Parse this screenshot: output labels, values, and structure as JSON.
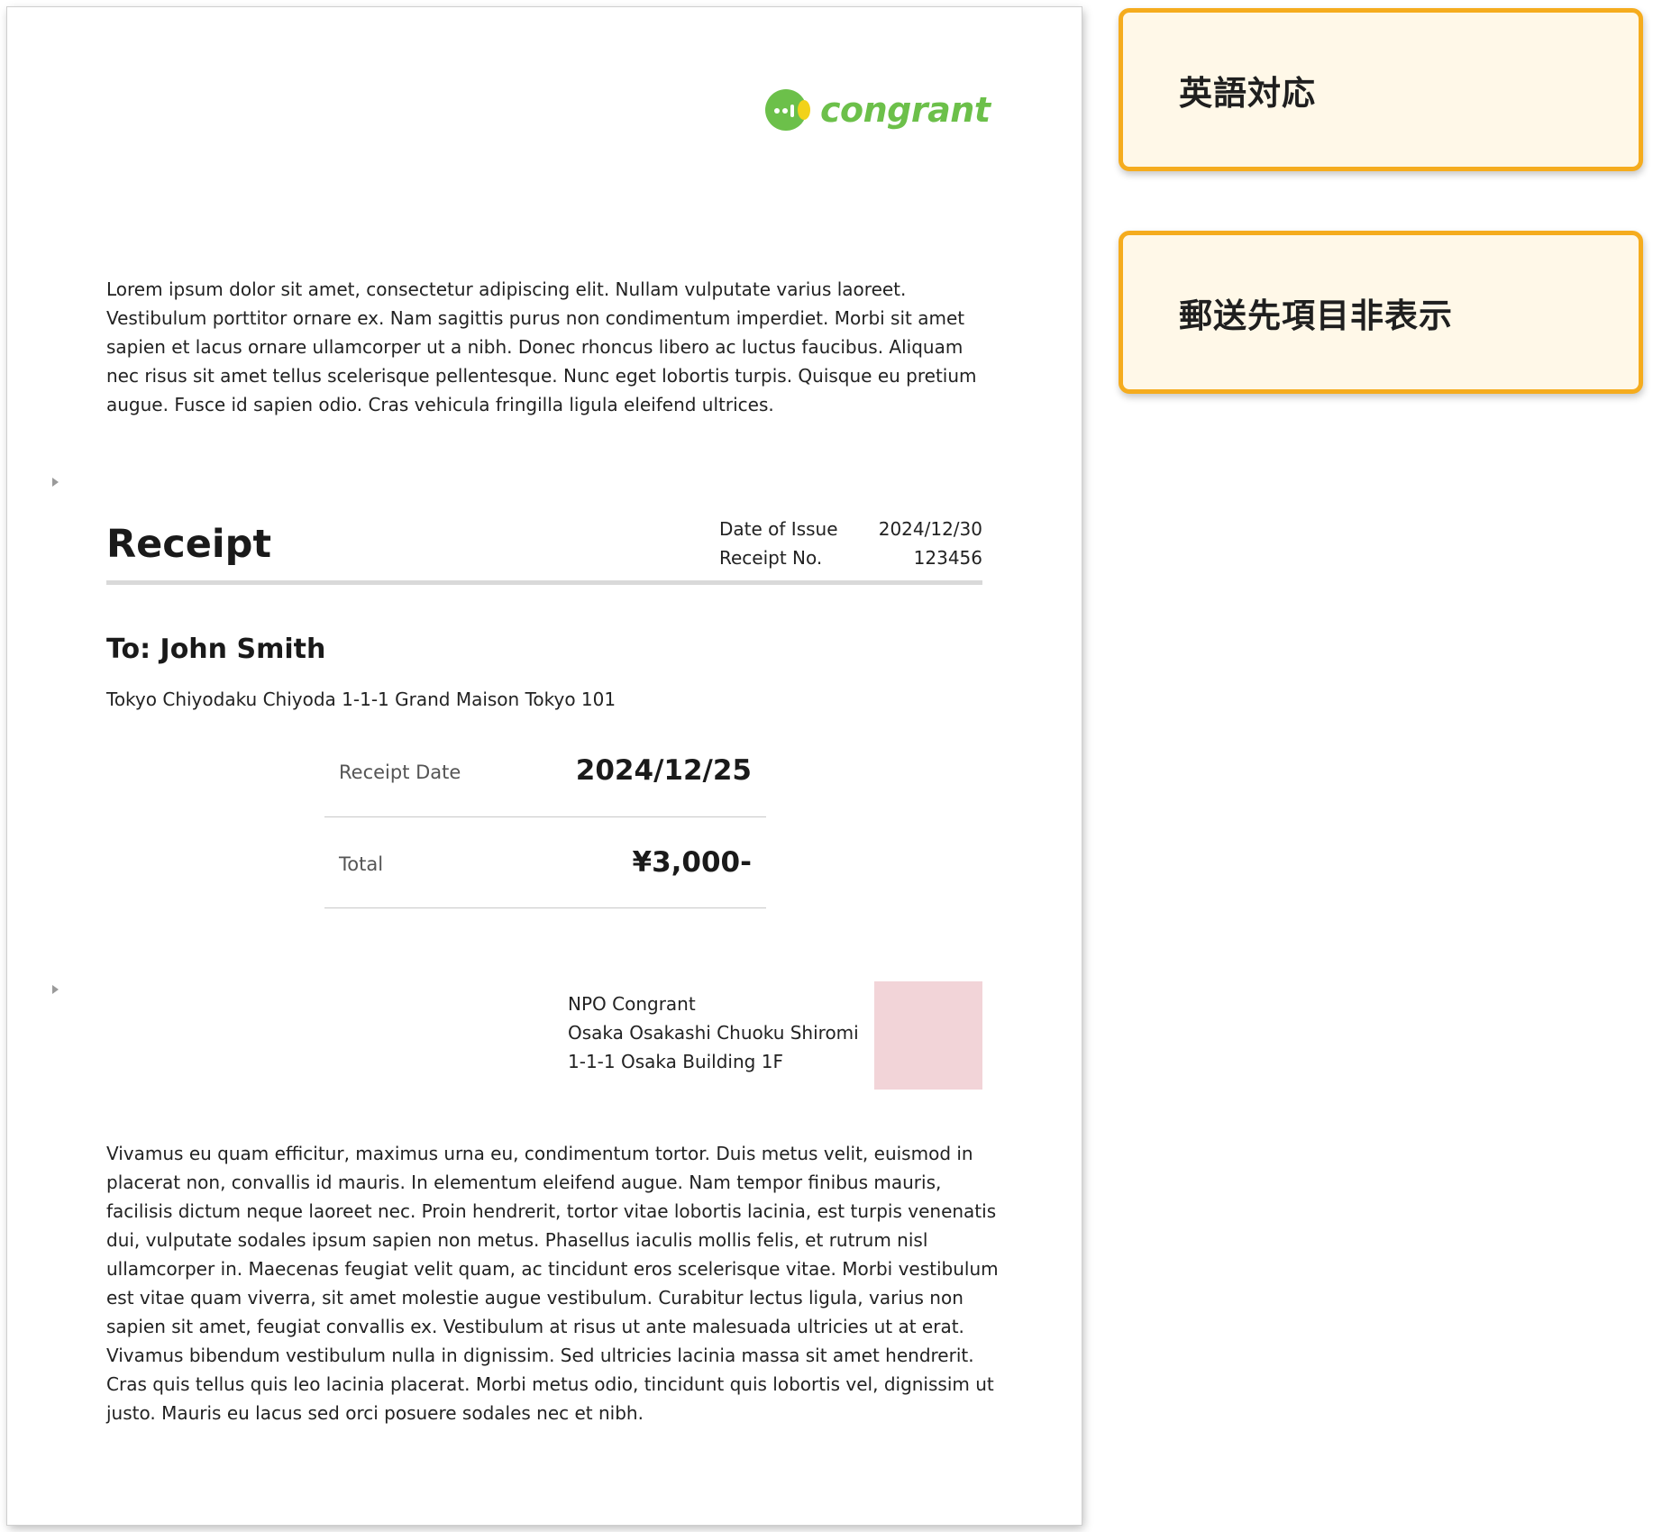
{
  "logo": {
    "text": "congrant",
    "color": "#6cc04a",
    "accent_color": "#f2d21a"
  },
  "intro_text": "Lorem ipsum dolor sit amet, consectetur adipiscing elit. Nullam vulputate varius laoreet. Vestibulum porttitor ornare ex. Nam sagittis purus non condimentum imperdiet. Morbi sit amet sapien et lacus ornare ullamcorper ut a nibh. Donec rhoncus libero ac luctus faucibus. Aliquam nec risus sit amet tellus scelerisque pellentesque. Nunc eget lobortis turpis. Quisque eu pretium augue. Fusce id sapien odio. Cras vehicula fringilla ligula eleifend ultrices.",
  "receipt": {
    "title": "Receipt",
    "date_of_issue_label": "Date of Issue",
    "date_of_issue": "2024/12/30",
    "receipt_no_label": "Receipt No.",
    "receipt_no": "123456"
  },
  "recipient": {
    "name": "To: John Smith",
    "address": "Tokyo Chiyodaku Chiyoda 1-1-1 Grand Maison Tokyo 101"
  },
  "summary": {
    "receipt_date_label": "Receipt Date",
    "receipt_date": "2024/12/25",
    "total_label": "Total",
    "total": "¥3,000-"
  },
  "issuer": {
    "name": "NPO Congrant",
    "address_line1": "Osaka Osakashi Chuoku Shiromi",
    "address_line2": "1-1-1 Osaka Building 1F",
    "stamp_color": "#f2d4d8"
  },
  "outro_text": "Vivamus eu quam efficitur, maximus urna eu, condimentum tortor. Duis metus velit, euismod in placerat non, convallis id mauris. In elementum eleifend augue. Nam tempor finibus mauris, facilisis dictum neque laoreet nec. Proin hendrerit, tortor vitae lobortis lacinia, est turpis venenatis dui, vulputate sodales ipsum sapien non metus. Phasellus iaculis mollis felis, et rutrum nisl ullamcorper in. Maecenas feugiat velit quam, ac tincidunt eros scelerisque vitae. Morbi vestibulum est vitae quam viverra, sit amet molestie augue vestibulum. Curabitur lectus ligula, varius non sapien sit amet, feugiat convallis ex. Vestibulum at risus ut ante malesuada ultricies ut at erat. Vivamus bibendum vestibulum nulla in dignissim. Sed ultricies lacinia massa sit amet hendrerit. Cras quis tellus quis leo lacinia placerat. Morbi metus odio, tincidunt quis lobortis vel, dignissim ut justo. Mauris eu lacus sed orci posuere sodales nec et nibh.",
  "notes": [
    {
      "label": "英語対応"
    },
    {
      "label": "郵送先項目非表示"
    }
  ],
  "colors": {
    "note_border": "#f5ac1e",
    "note_background": "#fff8e8",
    "rule": "#d9d9d9"
  }
}
